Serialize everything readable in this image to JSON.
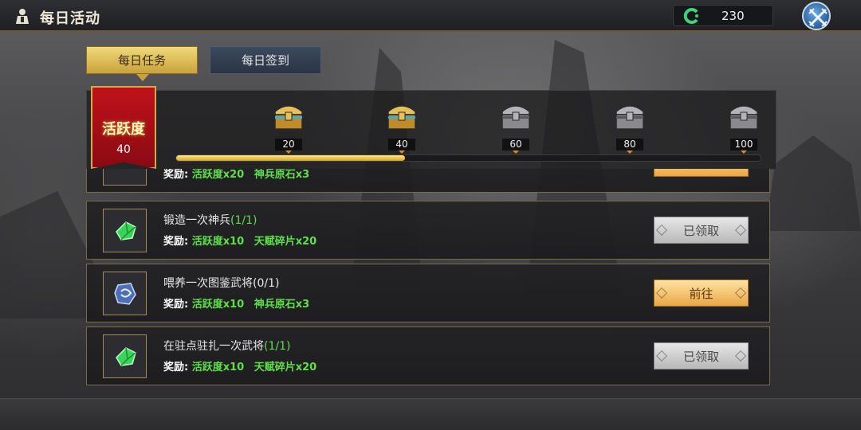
{
  "header": {
    "title": "每日活动",
    "currency_value": "230"
  },
  "tabs": [
    {
      "label": "每日任务",
      "active": true
    },
    {
      "label": "每日签到",
      "active": false
    }
  ],
  "activity": {
    "label": "活跃度",
    "value": "40",
    "progress_fraction": 0.4,
    "milestones": [
      {
        "value": "20",
        "chest": "gold-chest-icon",
        "opened": true
      },
      {
        "value": "40",
        "chest": "gold-chest-icon",
        "opened": true
      },
      {
        "value": "60",
        "chest": "silver-chest-icon",
        "opened": false
      },
      {
        "value": "80",
        "chest": "silver-chest-icon",
        "opened": false
      },
      {
        "value": "100",
        "chest": "silver-chest-icon",
        "opened": false
      }
    ]
  },
  "tasks": [
    {
      "title": "",
      "progress": "",
      "reward_label": "奖励:",
      "rewards": [
        "活跃度x20",
        "神兵原石x3"
      ],
      "button": "",
      "icon": "partial-task-icon"
    },
    {
      "title": "锻造一次神兵",
      "progress": "(1/1)",
      "reward_label": "奖励:",
      "rewards": [
        "活跃度x10",
        "天赋碎片x20"
      ],
      "button": "已领取",
      "icon": "green-crystal-icon"
    },
    {
      "title": "喂养一次图鉴武将",
      "progress": "(0/1)",
      "reward_label": "奖励:",
      "rewards": [
        "活跃度x10",
        "神兵原石x3"
      ],
      "button": "前往",
      "icon": "blue-stone-icon"
    },
    {
      "title": "在驻点驻扎一次武将",
      "progress": "(1/1)",
      "reward_label": "奖励:",
      "rewards": [
        "活跃度x10",
        "天赋碎片x20"
      ],
      "button": "已领取",
      "icon": "green-crystal-icon"
    }
  ],
  "colors": {
    "reward_green": "#5fe04a",
    "gold_accent": "#d4a425",
    "badge_red": "#c0121a"
  }
}
